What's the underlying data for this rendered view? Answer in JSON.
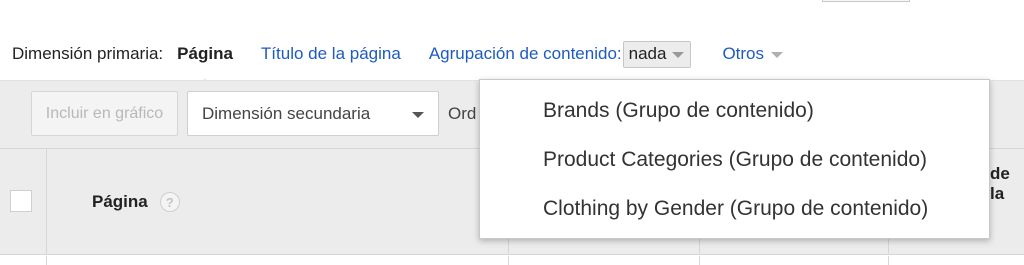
{
  "primary_dimension": {
    "label": "Dimensión primaria:",
    "selected": "Página",
    "options": [
      "Título de la página"
    ],
    "content_grouping": {
      "label": "Agrupación de contenido:",
      "value": "nada"
    },
    "others_label": "Otros"
  },
  "toolbar": {
    "include_chart": "Incluir en gráfico",
    "secondary_dimension": "Dimensión secundaria",
    "sort_label": "Ord"
  },
  "table": {
    "page_column": "Página",
    "help_glyph": "?",
    "right_column_partial": "de\nla"
  },
  "dropdown": {
    "items": [
      "Brands (Grupo de contenido)",
      "Product Categories (Grupo de contenido)",
      "Clothing by Gender (Grupo de contenido)"
    ]
  },
  "icons": {
    "caret": "caret-down-icon",
    "help": "help-circle-icon"
  }
}
